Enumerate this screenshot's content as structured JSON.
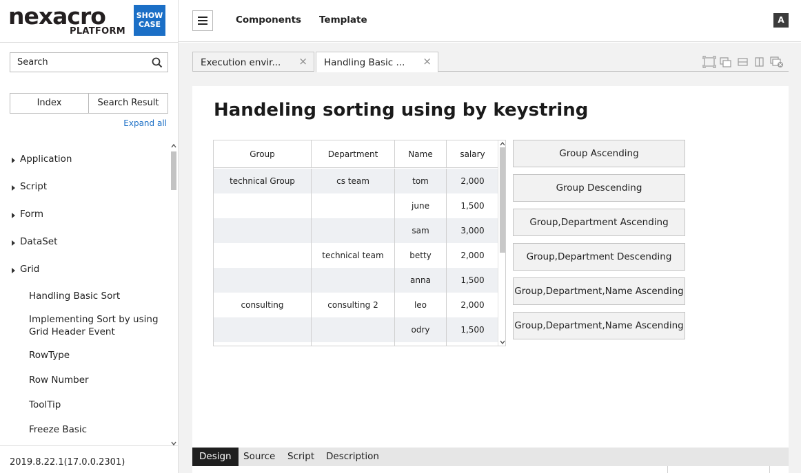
{
  "brand": {
    "logo": "nexacro",
    "logo_sub": "PLATFORM",
    "badge_line1": "SHOW",
    "badge_line2": "CASE",
    "brand_color": "#1b6fc6"
  },
  "sidebar": {
    "search_placeholder": "Search",
    "segments": [
      "Index",
      "Search Result"
    ],
    "expand_all": "Expand all",
    "tree": [
      {
        "label": "Application",
        "icon": "caret-right-icon"
      },
      {
        "label": "Script",
        "icon": "caret-right-icon"
      },
      {
        "label": "Form",
        "icon": "caret-right-icon"
      },
      {
        "label": "DataSet",
        "icon": "caret-right-icon"
      },
      {
        "label": "Grid",
        "icon": "caret-right-icon"
      }
    ],
    "grid_children": [
      "Handling Basic Sort",
      "Implementing Sort by using Grid Header Event",
      "RowType",
      "Row Number",
      "ToolTip",
      "Freeze Basic"
    ],
    "version": "2019.8.22.1(17.0.0.2301)"
  },
  "topbar": {
    "nav": [
      "Components",
      "Template"
    ],
    "user_initial": "A"
  },
  "tabs": [
    {
      "label": "Execution envir...",
      "close": "×"
    },
    {
      "label": "Handling Basic ...",
      "close": "×"
    }
  ],
  "page": {
    "title": "Handeling sorting using by keystring"
  },
  "grid": {
    "columns": [
      "Group",
      "Department",
      "Name",
      "salary"
    ],
    "rows": [
      [
        "technical Group",
        "cs team",
        "tom",
        "2,000"
      ],
      [
        "",
        "",
        "june",
        "1,500"
      ],
      [
        "",
        "",
        "sam",
        "3,000"
      ],
      [
        "",
        "technical team",
        "betty",
        "2,000"
      ],
      [
        "",
        "",
        "anna",
        "1,500"
      ],
      [
        "consulting",
        "consulting 2",
        "leo",
        "2,000"
      ],
      [
        "",
        "",
        "odry",
        "1,500"
      ]
    ]
  },
  "buttons": [
    "Group Ascending",
    "Group Descending",
    "Group,Department Ascending",
    "Group,Department Descending",
    "Group,Department,Name Ascending",
    "Group,Department,Name Ascending"
  ],
  "bottom_tabs": [
    "Design",
    "Source",
    "Script",
    "Description"
  ]
}
